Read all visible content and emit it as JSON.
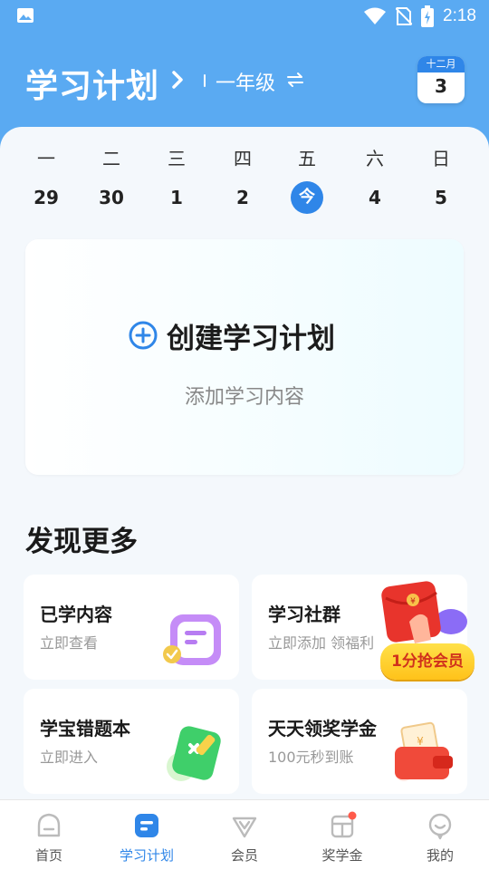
{
  "status_bar": {
    "time": "2:18"
  },
  "header": {
    "title": "学习计划",
    "grade": "一年级",
    "calendar": {
      "month": "十二月",
      "day": "3"
    }
  },
  "week": {
    "days": [
      {
        "weekday": "一",
        "date": "29"
      },
      {
        "weekday": "二",
        "date": "30"
      },
      {
        "weekday": "三",
        "date": "1"
      },
      {
        "weekday": "四",
        "date": "2"
      },
      {
        "weekday": "五",
        "date": "今"
      },
      {
        "weekday": "六",
        "date": "4"
      },
      {
        "weekday": "日",
        "date": "5"
      }
    ]
  },
  "plan": {
    "create_label": "创建学习计划",
    "subtitle": "添加学习内容"
  },
  "discover": {
    "title": "发现更多",
    "tiles": [
      {
        "title": "已学内容",
        "sub": "立即查看"
      },
      {
        "title": "学习社群",
        "sub": "立即添加 领福利"
      },
      {
        "title": "学宝错题本",
        "sub": "立即进入"
      },
      {
        "title": "天天领奖学金",
        "sub": "100元秒到账"
      }
    ],
    "promo": "1分抢会员"
  },
  "nav": {
    "items": [
      {
        "label": "首页"
      },
      {
        "label": "学习计划"
      },
      {
        "label": "会员"
      },
      {
        "label": "奖学金"
      },
      {
        "label": "我的"
      }
    ]
  },
  "colors": {
    "brand": "#5aaaf2",
    "accent": "#2f86e8",
    "promo": "#ffc21a",
    "badge": "#ff5a4a"
  }
}
